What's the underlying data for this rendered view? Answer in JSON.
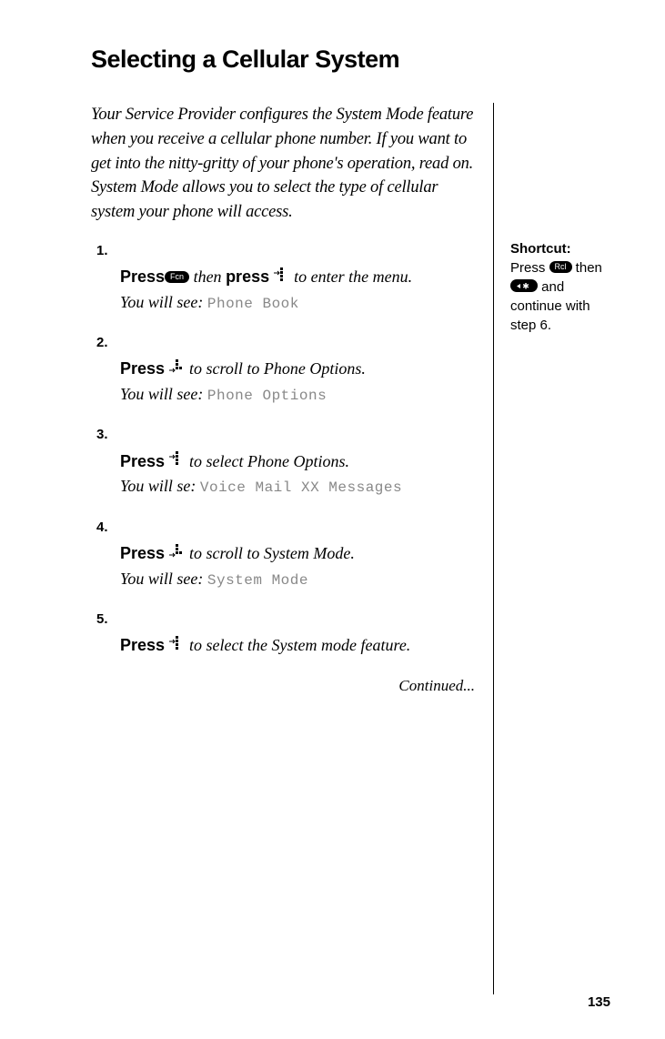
{
  "title": "Selecting a Cellular System",
  "intro": "Your Service Provider configures the System Mode feature when you receive a cellular phone number. If you want to get into the nitty-gritty of your phone's operation, read on. System Mode allows you to select the type of cellular system your phone will access.",
  "steps": [
    {
      "num": "1.",
      "press": "Press",
      "key": "Fcn",
      "mid": " then ",
      "press2": "press",
      "joy": "right",
      "tail": " to enter the menu.",
      "see_label": "You will see:",
      "display": "Phone Book"
    },
    {
      "num": "2.",
      "press": "Press",
      "joy": "down",
      "tail": " to scroll to Phone Options.",
      "see_label": "You will see:",
      "display": "Phone Options"
    },
    {
      "num": "3.",
      "press": "Press",
      "joy": "right",
      "tail": " to select Phone Options.",
      "see_label": "You will se:",
      "display": "Voice Mail XX Messages"
    },
    {
      "num": "4.",
      "press": "Press",
      "joy": "down",
      "tail": " to scroll to System Mode.",
      "see_label": "You will see:",
      "display": "System Mode"
    },
    {
      "num": "5.",
      "press": "Press",
      "joy": "right",
      "tail": " to select the System mode feature.",
      "see_label": "",
      "display": ""
    }
  ],
  "continued": "Continued...",
  "shortcut": {
    "title": "Shortcut:",
    "line1a": "Press ",
    "key1": "Rcl",
    "line1b": " then",
    "key2": "✱",
    "line2": " and continue with step 6."
  },
  "page_number": "135"
}
